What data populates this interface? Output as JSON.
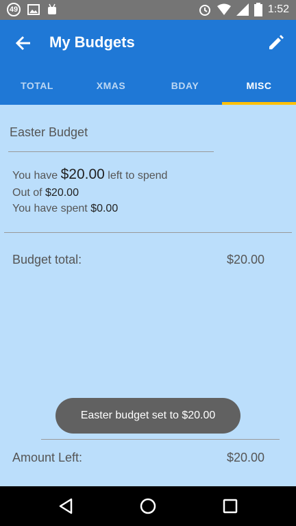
{
  "status_bar": {
    "notification_count": "49",
    "time": "1:52"
  },
  "app_bar": {
    "title": "My Budgets"
  },
  "tabs": [
    {
      "label": "TOTAL",
      "active": false
    },
    {
      "label": "XMAS",
      "active": false
    },
    {
      "label": "BDAY",
      "active": false
    },
    {
      "label": "MISC",
      "active": true
    }
  ],
  "budget": {
    "name": "Easter Budget",
    "left_prefix": "You have",
    "left_amount": "$20.00",
    "left_suffix": "left to spend",
    "out_of_prefix": "Out of",
    "out_of_amount": "$20.00",
    "spent_prefix": "You have spent",
    "spent_amount": "$0.00"
  },
  "summary": {
    "total_label": "Budget total:",
    "total_value": "$20.00",
    "left_label": "Amount Left:",
    "left_value": "$20.00"
  },
  "toast": {
    "message": "Easter budget set to $20.00"
  },
  "colors": {
    "primary": "#1f78d6",
    "accent": "#ffc107",
    "background": "#bbdefb"
  }
}
